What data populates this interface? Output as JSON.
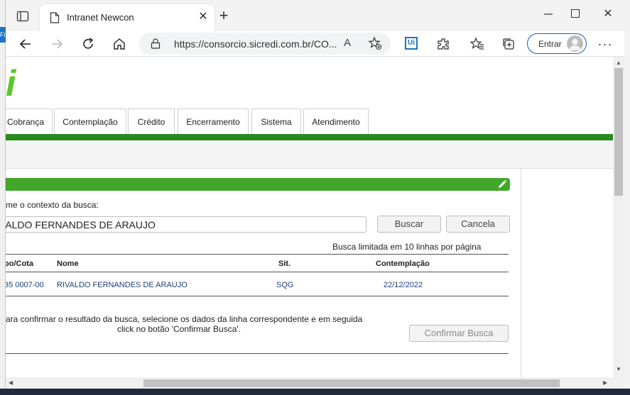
{
  "browser": {
    "tab_title": "Intranet Newcon",
    "url": "https://consorcio.sicredi.com.br/CO...",
    "read_aloud_glyph": "A",
    "ext_label": "Ui",
    "signin_label": "Entrar"
  },
  "left_strip": {
    "label": "Fi"
  },
  "page": {
    "logo_fragment": "i",
    "menu": [
      "Cobrança",
      "Contemplação",
      "Crédito",
      "Encerramento",
      "Sistema",
      "Atendimento"
    ],
    "search_label": "me o contexto da busca:",
    "search_value": "VALDO FERNANDES DE ARAUJO",
    "buscar_label": "Buscar",
    "cancela_label": "Cancela",
    "limit_note": "Busca limitada em 10 linhas por página",
    "table": {
      "columns": [
        "po/Cota",
        "Nome",
        "Sit.",
        "Contemplação"
      ],
      "rows": [
        {
          "cota": "35 0007-00",
          "nome": "RIVALDO FERNANDES DE ARAUJO",
          "sit": "SQG",
          "contemplacao": "22/12/2022"
        }
      ]
    },
    "confirm_line1": "ara confirmar o resultado da busca, selecione os dados da linha correspondente e em seguida",
    "confirm_line2": "click no botão 'Confirmar Busca'.",
    "confirm_button": "Confirmar Busca"
  },
  "colors": {
    "green_bar": "#29891e",
    "panel_header": "#42a62a",
    "logo": "#5cc72a",
    "row_text": "#1c3f7a"
  }
}
